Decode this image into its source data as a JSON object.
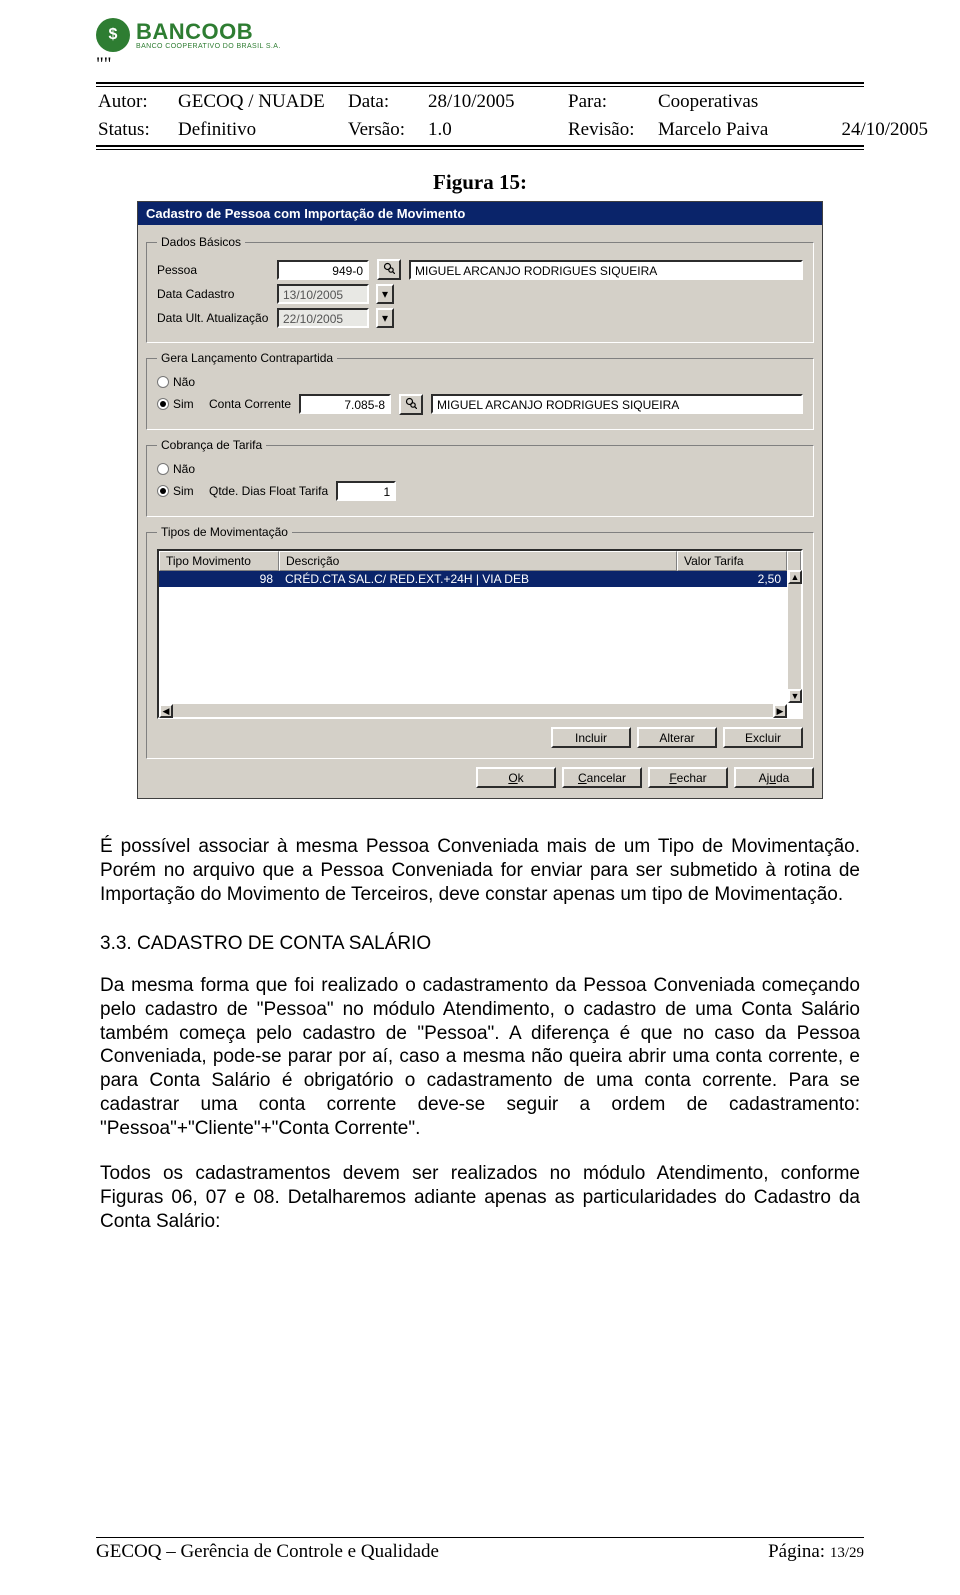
{
  "header": {
    "logo_brand": "BANCOOB",
    "logo_sub": "BANCO COOPERATIVO DO BRASIL S.A.",
    "quote_mark": "\"\"",
    "autor_label": "Autor:",
    "autor_value": "GECOQ / NUADE",
    "status_label": "Status:",
    "status_value": "Definitivo",
    "data_label": "Data:",
    "data_value": "28/10/2005",
    "versao_label": "Versão:",
    "versao_value": "1.0",
    "para_label": "Para:",
    "para_value": "Cooperativas",
    "revisao_label": "Revisão:",
    "revisao_value": "Marcelo Paiva",
    "revisao_date": "24/10/2005"
  },
  "figure_title": "Figura 15:",
  "dialog": {
    "title": "Cadastro de Pessoa com Importação de Movimento",
    "dados_basicos": {
      "legend": "Dados Básicos",
      "pessoa_label": "Pessoa",
      "pessoa_code": "949-0",
      "pessoa_nome": "MIGUEL ARCANJO RODRIGUES SIQUEIRA",
      "data_cadastro_label": "Data Cadastro",
      "data_cadastro_value": "13/10/2005",
      "data_atualizacao_label": "Data Ult. Atualização",
      "data_atualizacao_value": "22/10/2005"
    },
    "contrapartida": {
      "legend": "Gera Lançamento Contrapartida",
      "nao_label": "Não",
      "sim_label": "Sim",
      "conta_corrente_label": "Conta Corrente",
      "conta_corrente_value": "7.085-8",
      "pessoa_nome": "MIGUEL ARCANJO RODRIGUES SIQUEIRA"
    },
    "cobranca": {
      "legend": "Cobrança de Tarifa",
      "nao_label": "Não",
      "sim_label": "Sim",
      "qtde_label": "Qtde. Dias Float Tarifa",
      "qtde_value": "1"
    },
    "tipos": {
      "legend": "Tipos de Movimentação",
      "col_tipo": "Tipo Movimento",
      "col_desc": "Descrição",
      "col_valor": "Valor Tarifa",
      "row": {
        "tipo": "98",
        "desc": "CRÉD.CTA SAL.C/ RED.EXT.+24H | VIA DEB",
        "valor": "2,50"
      }
    },
    "buttons": {
      "incluir": "Incluir",
      "alterar": "Alterar",
      "excluir": "Excluir",
      "ok": "Ok",
      "cancelar": "Cancelar",
      "fechar": "Fechar",
      "ajuda": "Ajuda"
    }
  },
  "body": {
    "p1": "É possível associar à mesma Pessoa Conveniada mais de um Tipo de Movimentação. Porém no arquivo que a Pessoa Conveniada for enviar para ser submetido à rotina de Importação do Movimento de Terceiros, deve constar apenas um tipo de Movimentação.",
    "section": "3.3. CADASTRO DE CONTA SALÁRIO",
    "p2": "Da mesma forma que foi realizado o cadastramento da Pessoa Conveniada começando pelo cadastro de \"Pessoa\" no módulo Atendimento, o cadastro de uma Conta Salário também começa pelo cadastro de \"Pessoa\". A diferença é que no caso da Pessoa Conveniada, pode-se parar por aí, caso a mesma não queira abrir uma conta corrente, e para Conta Salário é obrigatório o cadastramento de uma conta corrente. Para se cadastrar uma conta corrente deve-se seguir a ordem de cadastramento: \"Pessoa\"+\"Cliente\"+\"Conta Corrente\".",
    "p3": "Todos os cadastramentos devem ser realizados no módulo Atendimento, conforme Figuras 06, 07 e 08. Detalharemos adiante apenas as particularidades do Cadastro da Conta Salário:"
  },
  "footer": {
    "left": "GECOQ – Gerência de Controle e Qualidade",
    "right_label": "Página: ",
    "right_value": "13/29"
  }
}
